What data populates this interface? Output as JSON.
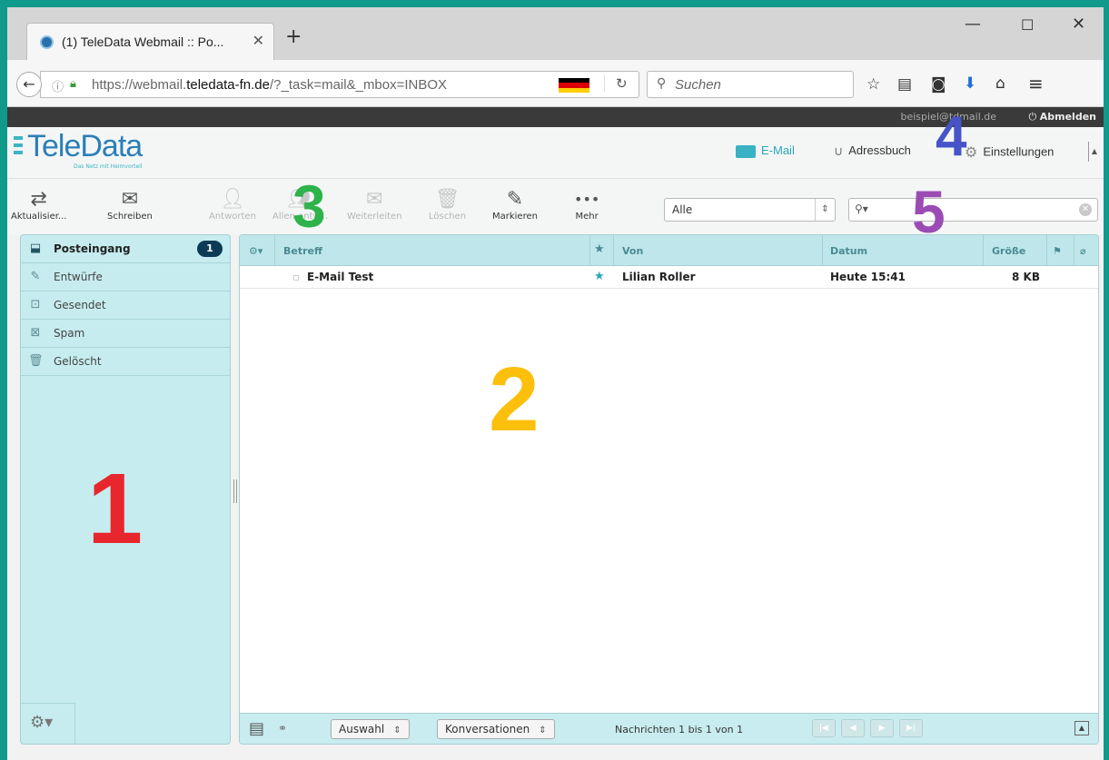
{
  "browser": {
    "tab_title": "(1) TeleData Webmail :: Po...",
    "url_prefix": "https://webmail.",
    "url_domain": "teledata-fn.de",
    "url_suffix": "/?_task=mail&_mbox=INBOX",
    "search_placeholder": "Suchen",
    "flag_colors": [
      "#000000",
      "#dd0000",
      "#ffce00"
    ]
  },
  "topline": {
    "user": "beispiel@tdmail.de",
    "logout": "Abmelden"
  },
  "brand": {
    "name": "TeleData",
    "slogan": "Das Netz mit Heimvorteil",
    "accent": "#2a7fb8"
  },
  "topnav": {
    "email": "E-Mail",
    "addressbook": "Adressbuch",
    "settings": "Einstellungen"
  },
  "toolbar": {
    "refresh": "Aktualisier...",
    "compose": "Schreiben",
    "reply": "Antworten",
    "reply_all": "Allen antw...",
    "forward": "Weiterleiten",
    "delete": "Löschen",
    "mark": "Markieren",
    "more": "Mehr",
    "filter_value": "Alle"
  },
  "folders": [
    {
      "label": "Posteingang",
      "icon": "inbox-icon",
      "unread": "1"
    },
    {
      "label": "Entwürfe",
      "icon": "pencil-icon"
    },
    {
      "label": "Gesendet",
      "icon": "sent-icon"
    },
    {
      "label": "Spam",
      "icon": "spam-icon"
    },
    {
      "label": "Gelöscht",
      "icon": "trash-icon"
    }
  ],
  "messagelist": {
    "columns": {
      "subject": "Betreff",
      "from": "Von",
      "date": "Datum",
      "size": "Größe"
    },
    "rows": [
      {
        "subject": "E-Mail Test",
        "from": "Lilian Roller",
        "date": "Heute 15:41",
        "size": "8 KB",
        "flagged": true
      }
    ]
  },
  "footer": {
    "select": "Auswahl",
    "threads": "Konversationen",
    "count": "Nachrichten 1 bis 1 von 1"
  },
  "annotations": [
    {
      "label": "1",
      "color": "#e8262d"
    },
    {
      "label": "2",
      "color": "#fcbf0c"
    },
    {
      "label": "3",
      "color": "#2db34a"
    },
    {
      "label": "4",
      "color": "#4654c8"
    },
    {
      "label": "5",
      "color": "#9a4cb4"
    }
  ]
}
